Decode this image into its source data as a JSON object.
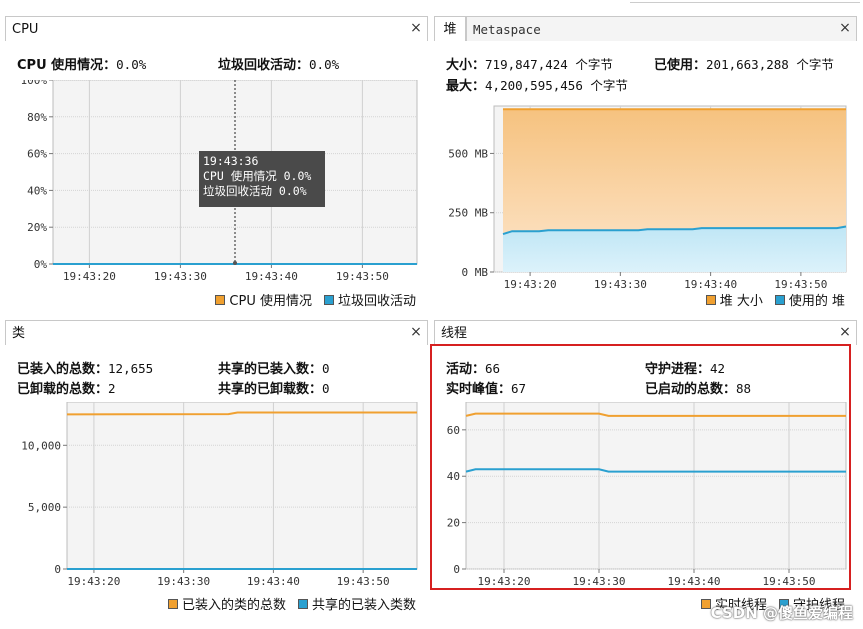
{
  "colors": {
    "orange": "#f0a030",
    "blue": "#2aa0d0",
    "highlight": "#d62020"
  },
  "cpu": {
    "tab": "CPU",
    "usage_label": "CPU 使用情况：",
    "usage_value": "0.0%",
    "gc_label": "垃圾回收活动：",
    "gc_value": "0.0%",
    "tooltip": {
      "time": "19:43:36",
      "usage": "CPU 使用情况  0.0%",
      "gc": "垃圾回收活动  0.0%"
    },
    "legend": [
      "CPU 使用情况",
      "垃圾回收活动"
    ]
  },
  "heap": {
    "tab_active": "堆",
    "tab_inactive": "Metaspace",
    "size_label": "大小：",
    "size_value": "719,847,424 个字节",
    "used_label": "已使用：",
    "used_value": "201,663,288 个字节",
    "max_label": "最大：",
    "max_value": "4,200,595,456 个字节",
    "legend": [
      "堆 大小",
      "使用的 堆"
    ]
  },
  "classes": {
    "tab": "类",
    "loaded_label": "已装入的总数：",
    "loaded_value": "12,655",
    "unloaded_label": "已卸载的总数：",
    "unloaded_value": "2",
    "shared_loaded_label": "共享的已装入数：",
    "shared_loaded_value": "0",
    "shared_unloaded_label": "共享的已卸载数：",
    "shared_unloaded_value": "0",
    "legend": [
      "已装入的类的总数",
      "共享的已装入类数"
    ]
  },
  "threads": {
    "tab": "线程",
    "live_label": "活动：",
    "live_value": "66",
    "peak_label": "实时峰值：",
    "peak_value": "67",
    "daemon_label": "守护进程：",
    "daemon_value": "42",
    "started_label": "已启动的总数：",
    "started_value": "88",
    "legend": [
      "实时线程",
      "守护线程"
    ]
  },
  "close_glyph": "×",
  "watermark": "CSDN @傻鱼爱编程",
  "chart_data": [
    {
      "type": "line",
      "panel": "cpu",
      "x": [
        "19:43:16",
        "19:43:36",
        "19:43:56"
      ],
      "xticks": [
        "19:43:20",
        "19:43:30",
        "19:43:40",
        "19:43:50"
      ],
      "yticks": [
        "0%",
        "20%",
        "40%",
        "60%",
        "80%",
        "100%"
      ],
      "ylim": [
        0,
        100
      ],
      "series": [
        {
          "name": "CPU 使用情况",
          "values": [
            0,
            0,
            0
          ]
        },
        {
          "name": "垃圾回收活动",
          "values": [
            0,
            0,
            0
          ]
        }
      ]
    },
    {
      "type": "area",
      "panel": "heap",
      "x": [
        "19:43:17",
        "19:43:18",
        "19:43:21",
        "19:43:22",
        "19:43:32",
        "19:43:33",
        "19:43:38",
        "19:43:39",
        "19:43:54",
        "19:43:55"
      ],
      "xticks": [
        "19:43:20",
        "19:43:30",
        "19:43:40",
        "19:43:50"
      ],
      "yticks": [
        "0 MB",
        "250 MB",
        "500 MB"
      ],
      "ylim": [
        0,
        700
      ],
      "series": [
        {
          "name": "堆 大小",
          "values": [
            686,
            686,
            686,
            686,
            686,
            686,
            686,
            686,
            686,
            686
          ]
        },
        {
          "name": "使用的 堆",
          "values": [
            160,
            172,
            172,
            176,
            176,
            180,
            180,
            185,
            185,
            192
          ]
        }
      ]
    },
    {
      "type": "line",
      "panel": "classes",
      "x": [
        "19:43:17",
        "19:43:35",
        "19:43:36",
        "19:43:56"
      ],
      "xticks": [
        "19:43:20",
        "19:43:30",
        "19:43:40",
        "19:43:50"
      ],
      "yticks": [
        "0",
        "5,000",
        "10,000"
      ],
      "ylim": [
        0,
        13500
      ],
      "series": [
        {
          "name": "已装入的类的总数",
          "values": [
            12500,
            12520,
            12655,
            12655
          ]
        },
        {
          "name": "共享的已装入类数",
          "values": [
            0,
            0,
            0,
            0
          ]
        }
      ]
    },
    {
      "type": "line",
      "panel": "threads",
      "x": [
        "19:43:16",
        "19:43:17",
        "19:43:18",
        "19:43:30",
        "19:43:31",
        "19:43:56"
      ],
      "xticks": [
        "19:43:20",
        "19:43:30",
        "19:43:40",
        "19:43:50"
      ],
      "yticks": [
        "0",
        "20",
        "40",
        "60"
      ],
      "ylim": [
        0,
        72
      ],
      "series": [
        {
          "name": "实时线程",
          "values": [
            66,
            67,
            67,
            67,
            66,
            66
          ]
        },
        {
          "name": "守护线程",
          "values": [
            42,
            43,
            43,
            43,
            42,
            42
          ]
        }
      ]
    }
  ]
}
